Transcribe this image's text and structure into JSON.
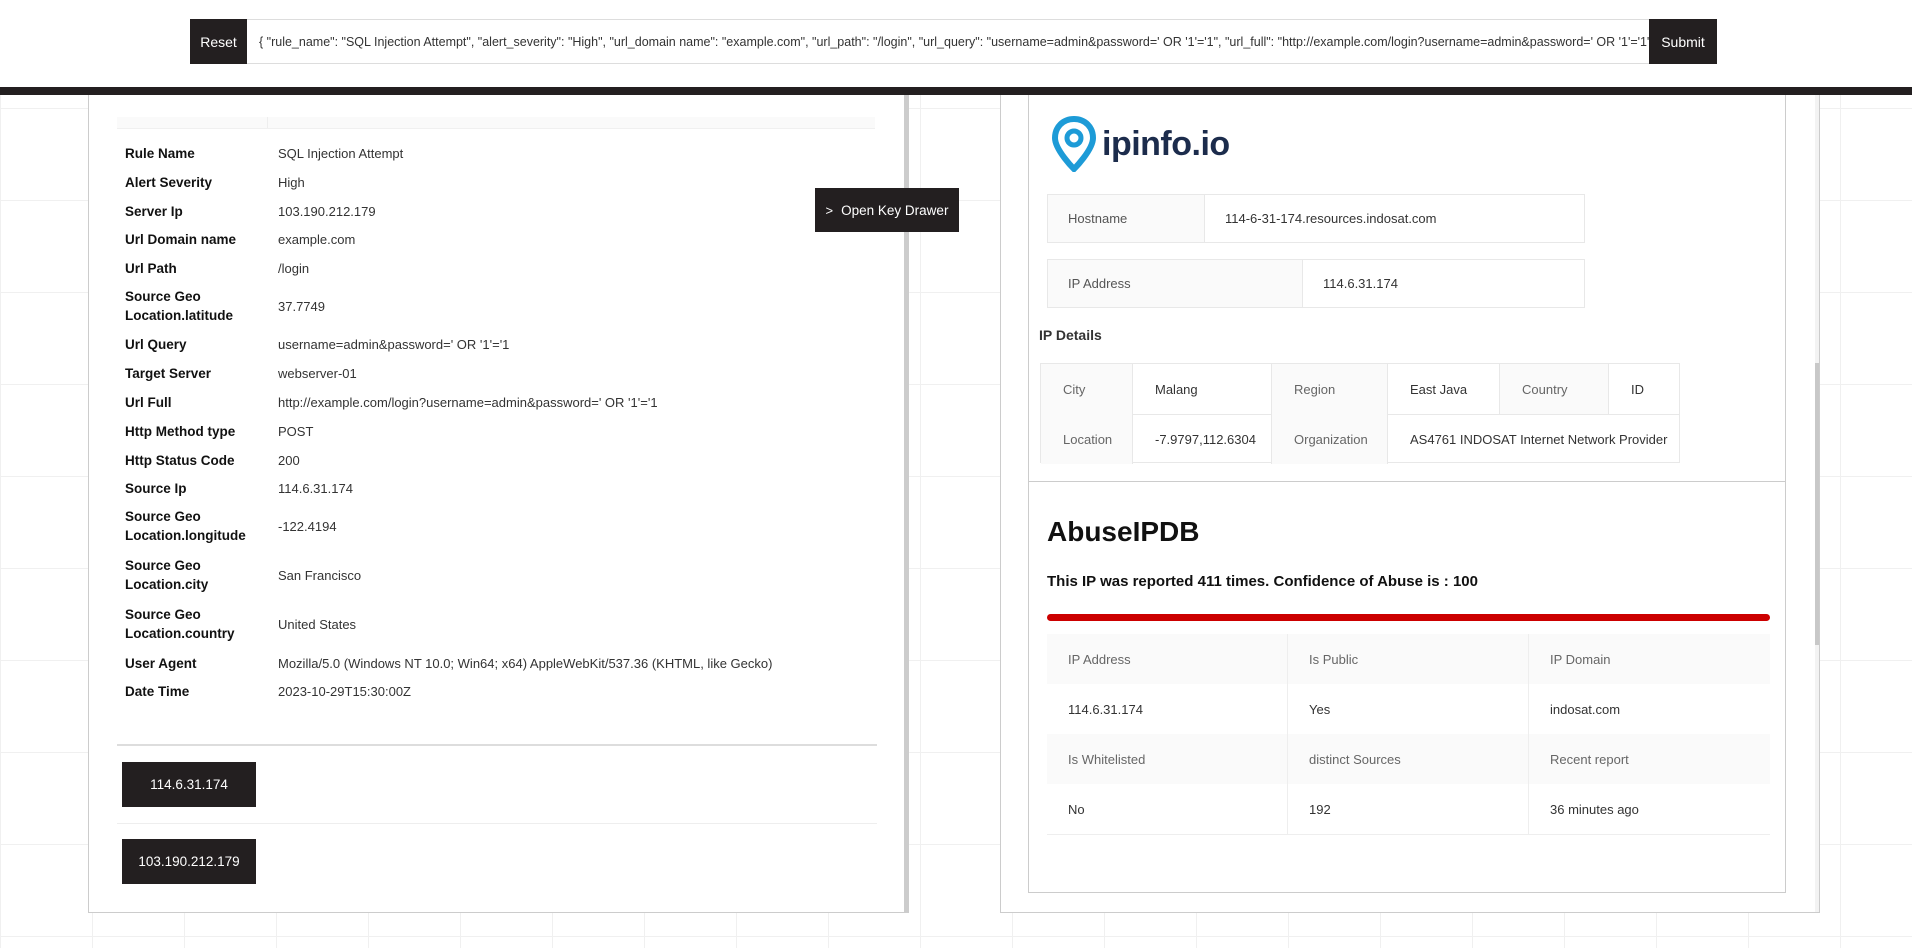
{
  "toolbar": {
    "reset_label": "Reset",
    "submit_label": "Submit",
    "query_value": "{   \"rule_name\": \"SQL Injection Attempt\",   \"alert_severity\": \"High\",   \"url_domain name\": \"example.com\",   \"url_path\": \"/login\",   \"url_query\": \"username=admin&password=' OR '1'='1\",   \"url_full\": \"http://example.com/login?username=admin&password=' OR '1'='1\""
  },
  "alert": {
    "rows": [
      {
        "key": "Rule Name",
        "value": "SQL Injection Attempt"
      },
      {
        "key": "Alert Severity",
        "value": "High"
      },
      {
        "key": "Server Ip",
        "value": "103.190.212.179"
      },
      {
        "key": "Url Domain name",
        "value": "example.com"
      },
      {
        "key": "Url Path",
        "value": "/login"
      },
      {
        "key": "Source Geo Location.latitude",
        "value": "37.7749"
      },
      {
        "key": "Url Query",
        "value": "username=admin&password=' OR '1'='1"
      },
      {
        "key": "Target Server",
        "value": "webserver-01"
      },
      {
        "key": "Url Full",
        "value": "http://example.com/login?username=admin&password=' OR '1'='1"
      },
      {
        "key": "Http Method type",
        "value": "POST"
      },
      {
        "key": "Http Status Code",
        "value": "200"
      },
      {
        "key": "Source Ip",
        "value": "114.6.31.174"
      },
      {
        "key": "Source Geo Location.longitude",
        "value": "-122.4194"
      },
      {
        "key": "Source Geo Location.city",
        "value": "San Francisco"
      },
      {
        "key": "Source Geo Location.country",
        "value": "United States"
      },
      {
        "key": "User Agent",
        "value": "Mozilla/5.0 (Windows NT 10.0; Win64; x64) AppleWebKit/537.36 (KHTML, like Gecko)"
      },
      {
        "key": "Date Time",
        "value": "2023-10-29T15:30:00Z"
      }
    ],
    "ip_buttons": [
      "114.6.31.174",
      "103.190.212.179"
    ],
    "drawer_label": "Open Key Drawer"
  },
  "ipinfo": {
    "logo_text": "ipinfo.io",
    "hostname_label": "Hostname",
    "hostname_value": "114-6-31-174.resources.indosat.com",
    "ip_label": "IP Address",
    "ip_value": "114.6.31.174",
    "details_title": "IP Details",
    "city_label": "City",
    "city_value": "Malang",
    "region_label": "Region",
    "region_value": "East Java",
    "country_label": "Country",
    "country_value": "ID",
    "location_label": "Location",
    "location_value": "-7.9797,112.6304",
    "org_label": "Organization",
    "org_value": "AS4761 INDOSAT Internet Network Provider"
  },
  "abuseipdb": {
    "title": "AbuseIPDB",
    "summary": "This IP was reported 411 times. Confidence of Abuse is : 100",
    "confidence": 100,
    "bar_color": "#cc0000",
    "table": [
      {
        "label": "IP Address",
        "value": "114.6.31.174"
      },
      {
        "label": "Is Public",
        "value": "Yes"
      },
      {
        "label": "IP Domain",
        "value": "indosat.com"
      },
      {
        "label": "Is Whitelisted",
        "value": "No"
      },
      {
        "label": "distinct Sources",
        "value": "192"
      },
      {
        "label": "Recent report",
        "value": "36 minutes ago"
      }
    ]
  },
  "colors": {
    "dark": "#231f20",
    "logo": "#1c2c4c",
    "logo_pin": "#1d9bd7"
  }
}
